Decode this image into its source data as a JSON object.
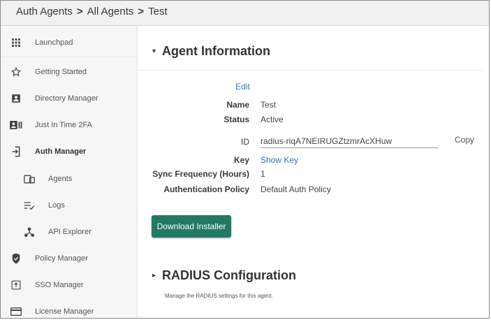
{
  "breadcrumb": {
    "items": [
      "Auth Agents",
      "All Agents",
      "Test"
    ],
    "separator": ">"
  },
  "sidebar": {
    "items": [
      {
        "label": "Launchpad",
        "icon": "grid-icon"
      },
      {
        "label": "Getting Started",
        "icon": "star-icon"
      },
      {
        "label": "Directory Manager",
        "icon": "contact-card-icon"
      },
      {
        "label": "Just In Time 2FA",
        "icon": "id-card-icon"
      },
      {
        "label": "Auth Manager",
        "icon": "login-icon",
        "active": true
      },
      {
        "label": "Agents",
        "icon": "devices-icon",
        "sub": true
      },
      {
        "label": "Logs",
        "icon": "list-check-icon",
        "sub": true
      },
      {
        "label": "API Explorer",
        "icon": "network-icon",
        "sub": true
      },
      {
        "label": "Policy Manager",
        "icon": "shield-icon"
      },
      {
        "label": "SSO Manager",
        "icon": "sign-in-box-icon"
      },
      {
        "label": "License Manager",
        "icon": "card-icon"
      }
    ]
  },
  "agent_info": {
    "title": "Agent Information",
    "edit_label": "Edit",
    "name_label": "Name",
    "name_value": "Test",
    "status_label": "Status",
    "status_value": "Active",
    "id_label": "ID",
    "id_value": "radius-riqA7NEIRUGZtzmrAcXHuw",
    "copy_label": "Copy",
    "key_label": "Key",
    "key_link": "Show Key",
    "sync_label": "Sync Frequency (Hours)",
    "sync_value": "1",
    "policy_label": "Authentication Policy",
    "policy_value": "Default Auth Policy",
    "download_label": "Download Installer"
  },
  "radius": {
    "title": "RADIUS Configuration",
    "description": "Manage the RADIUS settings for this agent."
  },
  "colors": {
    "accent_button": "#227a63",
    "link": "#2d74c4"
  }
}
